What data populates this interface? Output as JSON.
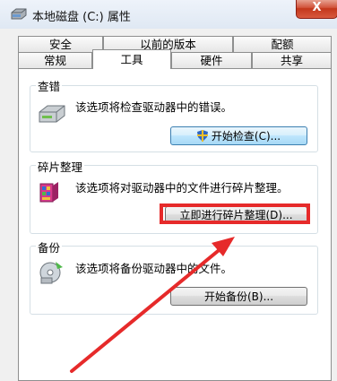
{
  "window": {
    "title": "本地磁盘 (C:) 属性",
    "close_label": "X"
  },
  "tabs_back": [
    {
      "label": "安全"
    },
    {
      "label": "以前的版本"
    },
    {
      "label": "配额"
    }
  ],
  "tabs_front": [
    {
      "label": "常规"
    },
    {
      "label": "工具"
    },
    {
      "label": "硬件"
    },
    {
      "label": "共享"
    }
  ],
  "active_tab": "工具",
  "sections": {
    "check": {
      "title": "查错",
      "description": "该选项将检查驱动器中的错误。",
      "button": "开始检查(C)..."
    },
    "defrag": {
      "title": "碎片整理",
      "description": "该选项将对驱动器中的文件进行碎片整理。",
      "button": "立即进行碎片整理(D)..."
    },
    "backup": {
      "title": "备份",
      "description": "该选项将备份驱动器中的文件。",
      "button": "开始备份(B)..."
    }
  },
  "colors": {
    "highlight": "#e62a2a",
    "arrow": "#e62a2a"
  }
}
